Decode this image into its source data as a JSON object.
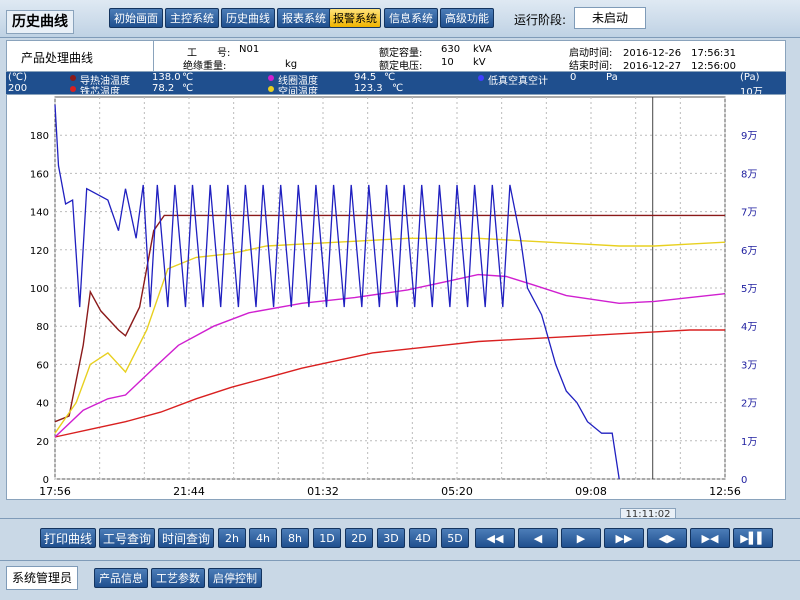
{
  "header": {
    "title": "历史曲线",
    "nav": [
      "初始画面",
      "主控系统",
      "历史曲线",
      "报表系统",
      "报警系统",
      "信息系统",
      "高级功能"
    ],
    "active_nav": "报警系统",
    "stage_label": "运行阶段:",
    "stage_value": "未启动"
  },
  "info": {
    "curve_label": "产品处理曲线",
    "work_no_label": "工　　号:",
    "work_no": "N01",
    "insulation_weight_label": "绝缘重量:",
    "insulation_weight_unit": "kg",
    "rated_capacity_label": "额定容量:",
    "rated_capacity": "630",
    "rated_capacity_unit": "kVA",
    "rated_voltage_label": "额定电压:",
    "rated_voltage": "10",
    "rated_voltage_unit": "kV",
    "start_time_label": "启动时间:",
    "start_time": "2016-12-26　17:56:31",
    "end_time_label": "结束时间:",
    "end_time": "2016-12-27　12:56:00"
  },
  "legend": {
    "left_unit": "(℃)",
    "left_max": "200",
    "right_unit": "(Pa)",
    "right_max": "10万",
    "items": [
      {
        "label": "导热油温度",
        "value": "138.0",
        "unit": "℃",
        "color": "#8b1a1a"
      },
      {
        "label": "铁芯温度",
        "value": "78.2",
        "unit": "℃",
        "color": "#d92020"
      },
      {
        "label": "线圈温度",
        "value": "94.5",
        "unit": "℃",
        "color": "#d020d0"
      },
      {
        "label": "空间温度",
        "value": "123.3",
        "unit": "℃",
        "color": "#e8d020"
      },
      {
        "label": "低真空真空计",
        "value": "0",
        "unit": "Pa",
        "color": "#2020c0"
      }
    ]
  },
  "chart_data": {
    "type": "line",
    "x_tick_labels": [
      "17:56",
      "21:44",
      "01:32",
      "05:20",
      "09:08",
      "12:56"
    ],
    "x_range_hours": [
      0,
      19
    ],
    "y_left": {
      "range": [
        0,
        200
      ],
      "ticks": [
        0,
        20,
        40,
        60,
        80,
        100,
        120,
        140,
        160,
        180
      ]
    },
    "y_right": {
      "range": [
        0,
        10
      ],
      "ticks": [
        "0",
        "1万",
        "2万",
        "3万",
        "4万",
        "5万",
        "6万",
        "7万",
        "8万",
        "9万"
      ]
    },
    "grid": true,
    "cursor_time": "11:11:02",
    "series": [
      {
        "name": "导热油温度",
        "color": "#8b1a1a",
        "axis": "left",
        "points": [
          [
            0,
            30
          ],
          [
            0.4,
            33
          ],
          [
            0.8,
            70
          ],
          [
            1.0,
            98
          ],
          [
            1.3,
            88
          ],
          [
            1.8,
            78
          ],
          [
            2.0,
            75
          ],
          [
            2.4,
            90
          ],
          [
            2.8,
            130
          ],
          [
            3.1,
            138
          ],
          [
            4,
            138
          ],
          [
            8,
            138
          ],
          [
            12,
            138
          ],
          [
            16,
            138
          ],
          [
            19,
            138
          ]
        ]
      },
      {
        "name": "铁芯温度",
        "color": "#d92020",
        "axis": "left",
        "points": [
          [
            0,
            22
          ],
          [
            1,
            26
          ],
          [
            2,
            30
          ],
          [
            3,
            35
          ],
          [
            4,
            42
          ],
          [
            5,
            48
          ],
          [
            6,
            53
          ],
          [
            7,
            58
          ],
          [
            8,
            62
          ],
          [
            9,
            66
          ],
          [
            10,
            68
          ],
          [
            11,
            70
          ],
          [
            12,
            72
          ],
          [
            13,
            73
          ],
          [
            14,
            74
          ],
          [
            15,
            75
          ],
          [
            16,
            76
          ],
          [
            17,
            77
          ],
          [
            18,
            78
          ],
          [
            19,
            78
          ]
        ]
      },
      {
        "name": "线圈温度",
        "color": "#d020d0",
        "axis": "left",
        "points": [
          [
            0,
            22
          ],
          [
            0.8,
            36
          ],
          [
            1.5,
            42
          ],
          [
            2.0,
            44
          ],
          [
            2.8,
            58
          ],
          [
            3.5,
            70
          ],
          [
            4.5,
            80
          ],
          [
            5.5,
            87
          ],
          [
            7,
            92
          ],
          [
            8.5,
            95
          ],
          [
            10,
            99
          ],
          [
            11,
            103
          ],
          [
            12,
            107
          ],
          [
            12.8,
            106
          ],
          [
            13.5,
            102
          ],
          [
            14.5,
            96
          ],
          [
            16,
            92
          ],
          [
            17,
            93
          ],
          [
            18,
            95
          ],
          [
            19,
            97
          ]
        ]
      },
      {
        "name": "空间温度",
        "color": "#e8d020",
        "axis": "left",
        "points": [
          [
            0,
            24
          ],
          [
            0.6,
            40
          ],
          [
            1.0,
            60
          ],
          [
            1.5,
            66
          ],
          [
            2.0,
            56
          ],
          [
            2.6,
            78
          ],
          [
            3.2,
            110
          ],
          [
            4,
            116
          ],
          [
            5,
            118
          ],
          [
            6,
            122
          ],
          [
            7,
            123
          ],
          [
            8,
            124
          ],
          [
            9,
            125
          ],
          [
            10,
            126
          ],
          [
            11,
            126
          ],
          [
            12,
            126
          ],
          [
            13,
            125
          ],
          [
            14,
            124
          ],
          [
            15,
            123
          ],
          [
            16,
            122
          ],
          [
            17,
            122
          ],
          [
            18,
            123
          ],
          [
            19,
            124
          ]
        ]
      },
      {
        "name": "低真空真空计",
        "color": "#2020c0",
        "axis": "right",
        "points": [
          [
            0,
            9.8
          ],
          [
            0.1,
            8.2
          ],
          [
            0.3,
            7.2
          ],
          [
            0.5,
            7.3
          ],
          [
            0.7,
            4.5
          ],
          [
            0.9,
            7.6
          ],
          [
            1.5,
            7.3
          ],
          [
            1.8,
            6.5
          ],
          [
            2.0,
            7.6
          ],
          [
            2.3,
            6.3
          ],
          [
            2.5,
            7.7
          ],
          [
            2.7,
            4.5
          ],
          [
            2.9,
            7.7
          ],
          [
            3.2,
            4.5
          ],
          [
            3.4,
            7.7
          ],
          [
            3.7,
            4.5
          ],
          [
            3.9,
            7.7
          ],
          [
            4.2,
            4.5
          ],
          [
            4.4,
            7.7
          ],
          [
            4.7,
            4.5
          ],
          [
            4.9,
            7.7
          ],
          [
            5.2,
            4.5
          ],
          [
            5.4,
            7.7
          ],
          [
            5.7,
            4.5
          ],
          [
            5.9,
            7.7
          ],
          [
            6.2,
            4.5
          ],
          [
            6.4,
            7.7
          ],
          [
            6.7,
            4.5
          ],
          [
            6.9,
            7.7
          ],
          [
            7.2,
            4.5
          ],
          [
            7.4,
            7.7
          ],
          [
            7.7,
            4.5
          ],
          [
            7.9,
            7.7
          ],
          [
            8.2,
            4.5
          ],
          [
            8.4,
            7.7
          ],
          [
            8.7,
            4.5
          ],
          [
            8.9,
            7.7
          ],
          [
            9.2,
            4.5
          ],
          [
            9.4,
            7.7
          ],
          [
            9.7,
            4.5
          ],
          [
            9.9,
            7.7
          ],
          [
            10.2,
            4.5
          ],
          [
            10.4,
            7.7
          ],
          [
            10.7,
            4.5
          ],
          [
            10.9,
            7.7
          ],
          [
            11.2,
            4.5
          ],
          [
            11.4,
            7.7
          ],
          [
            11.7,
            4.5
          ],
          [
            11.9,
            7.7
          ],
          [
            12.2,
            4.5
          ],
          [
            12.4,
            7.7
          ],
          [
            12.7,
            4.5
          ],
          [
            12.9,
            7.7
          ],
          [
            13.2,
            6.3
          ],
          [
            13.4,
            5.0
          ],
          [
            13.8,
            4.3
          ],
          [
            14.2,
            3.0
          ],
          [
            14.5,
            2.3
          ],
          [
            14.8,
            2.0
          ],
          [
            15.1,
            1.5
          ],
          [
            15.5,
            1.2
          ],
          [
            15.8,
            1.2
          ],
          [
            16.0,
            0.0
          ]
        ]
      }
    ]
  },
  "toolbar": {
    "buttons": [
      "打印曲线",
      "工号查询",
      "时间查询"
    ],
    "ranges": [
      "2h",
      "4h",
      "8h",
      "1D",
      "2D",
      "3D",
      "4D",
      "5D"
    ],
    "nav": [
      "◀◀",
      "◀",
      "▶",
      "▶▶",
      "◀▶",
      "▶◀",
      "▶▌▌"
    ]
  },
  "footer": {
    "user": "系统管理员",
    "buttons": [
      "产品信息",
      "工艺参数",
      "启停控制"
    ]
  }
}
